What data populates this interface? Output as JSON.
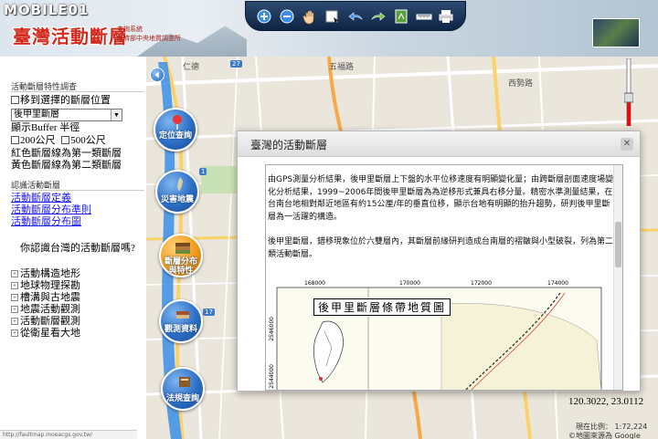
{
  "header": {
    "watermark": "MOBILE01",
    "logo_title": "臺灣活動斷層",
    "logo_sub1": "查詢系統",
    "logo_sub2": "經濟部中央地質調查所"
  },
  "toolbar": {
    "icons": [
      "zoom-in-icon",
      "zoom-out-icon",
      "pan-hand-icon",
      "select-icon",
      "rectangle-zoom-icon",
      "back-arrow-icon",
      "forward-arrow-icon",
      "full-extent-icon",
      "measure-ruler-icon",
      "print-icon"
    ]
  },
  "left_panel": {
    "section1_title": "活動斷層特性調查",
    "move_to_fault": "移到選擇的斷層位置",
    "selected_fault": "後甲里斷層",
    "buffer_label": "顯示Buffer 半徑",
    "buffer_200": "200公尺",
    "buffer_500": "500公尺",
    "legend_red": "紅色斷層線為第一類斷層",
    "legend_yellow": "黃色斷層線為第二類斷層",
    "section2_title": "認識活動斷層",
    "links": [
      "活動斷層定義",
      "活動斷層分布準則",
      "活動斷層分布圖"
    ],
    "question": "你認識台灣的活動斷層嗎?",
    "tree_items": [
      "活動構造地形",
      "地球物理探勘",
      "槽溝與古地震",
      "地震活動觀測",
      "活動斷層觀測",
      "從衛星看大地"
    ]
  },
  "nav_buttons": [
    {
      "label1": "定位查詢",
      "label2": ""
    },
    {
      "label1": "災害地震",
      "label2": ""
    },
    {
      "label1": "斷層分布",
      "label2": "與特性"
    },
    {
      "label1": "觀測資料",
      "label2": ""
    },
    {
      "label1": "法規查詢",
      "label2": ""
    }
  ],
  "map": {
    "labels": [
      "西勢路",
      "五福路",
      "仁德"
    ],
    "shields": [
      "27",
      "1",
      "17"
    ],
    "coordinates": "120.3022, 23.0112",
    "scale": "現在比例： 1:72,224",
    "source": "©地圖來源為 Google Map",
    "url": "http://faultmap.moeacgs.gov.tw/"
  },
  "popup": {
    "title": "臺灣的活動斷層",
    "paragraph1": "由GPS測量分析結果，後甲里斷層上下盤的水平位移速度有明顯變化量；由跨斷層剖面速度場變化分析結果，1999~2006年間後甲里斷層為為逆移形式兼具右移分量。精密水準測量結果，在台南台地相對鄰近地區有約15公厘/年的垂直位移，顯示台地有明顯的抬升趨勢，研判後甲里斷層為一活躍的構造。",
    "paragraph2": "後甲里斷層，錯移現象位於六雙層內，其斷層前緣研判造成台南層的褶皺與小型破裂，列為第二類活動斷層。",
    "geo_map_title": "後甲里斷層條帶地質圖",
    "geo_x_ticks": [
      "168000",
      "170000",
      "172000",
      "174000"
    ],
    "geo_y_ticks": [
      "2546000",
      "2544000"
    ]
  },
  "colors": {
    "accent_blue": "#2d6fc7",
    "active_orange": "#f09a1a",
    "toolbar_navy": "#0f2444"
  }
}
